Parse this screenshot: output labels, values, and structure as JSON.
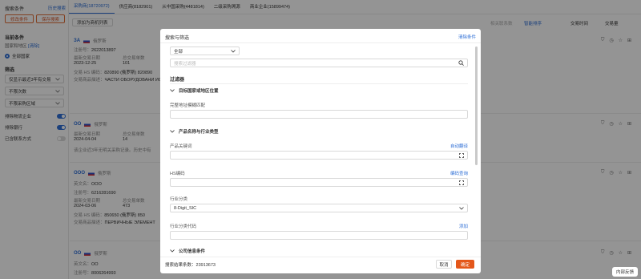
{
  "sidebar": {
    "title": "搜索条件",
    "history_link": "历史搜索",
    "modify_button": "修改条件",
    "save_button": "保存搜索",
    "current_conditions": "当前条件",
    "country_label": "国家和地区",
    "country_clear": "[清除]",
    "all_countries": "全部国家",
    "filter_heading": "筛选",
    "selects": [
      "仅显示最近3年有交易",
      "不限次数",
      "不限采购区域"
    ],
    "toggles": [
      {
        "label": "排除物流企业",
        "on": true
      },
      {
        "label": "排除银行",
        "on": true
      },
      {
        "label": "已含联系方式",
        "on": false
      }
    ]
  },
  "tabs": [
    {
      "label": "采购商(18720972)",
      "active": true
    },
    {
      "label": "供应商(8182901)",
      "active": false
    },
    {
      "label": "从中国采购(4481814)",
      "active": false
    },
    {
      "label": "二级采购溯源",
      "active": false
    },
    {
      "label": "商业企业(15899474)",
      "active": false
    }
  ],
  "toolbar": {
    "add_list": "添加为商机列表",
    "related_contacts": "相关联系数",
    "smart_sort": "智能排序",
    "trade_time": "交易时间",
    "trade_count": "交易量"
  },
  "rows": [
    {
      "name": "ЗА",
      "country": "俄罗斯",
      "reg_label": "注册号：",
      "reg": "2622013897",
      "last_label": "最新交易日期",
      "last_date": "2023-12-25",
      "total_label": "总交易单数",
      "total": "101",
      "hs_label": "交易 HS 编码：",
      "hs": "820890 (俄罗斯)  820890",
      "desc_label": "交易商品描述：",
      "desc": "ЧАСТИ ОБОРУДОВАНИ ИСКЛЮЧИТЕЛЬНО ДЛЯ"
    },
    {
      "name": "ОО",
      "country": "俄罗斯",
      "last_label": "最新交易日期",
      "last_date": "2024-04-04",
      "total_label": "总交易单数",
      "total": "14",
      "note": "该企业近3年无明关采购记录。历史中有"
    },
    {
      "name": "ООО",
      "country": "俄罗斯",
      "en_label": "英文名：",
      "en": "ООО",
      "reg_label": "注册号：",
      "reg": "6216281690",
      "last_label": "最新交易日期",
      "last_date": "2024-03-06",
      "total_label": "总交易单数",
      "total": "473",
      "hs_label": "交易 HS 编码：",
      "hs": "850650 (俄罗斯)  850",
      "desc_label": "交易商品描述：",
      "desc": "ПЕРВИЧНЫЕ ЭЛЕМЕНТ"
    },
    {
      "name": "ОО",
      "country": "俄罗斯",
      "en_label": "英文名：",
      "en": "ОО",
      "reg_label": "注册号：",
      "reg": "8006264993"
    }
  ],
  "modal": {
    "title": "搜索与筛选",
    "clear": "清除条件",
    "scope": "全部",
    "search_placeholder": "搜索过滤器",
    "filters_heading": "过滤器",
    "sec_region": "目标国家或地区位置",
    "address_label": "完整地址模糊匹配",
    "sec_product": "产品名称与行业类型",
    "keyword_label": "产品关键词",
    "auto_translate": "自动翻译",
    "hs_label": "HS编码",
    "hs_lookup": "编码查询",
    "industry_label": "行业分类",
    "industry_value": "8-Digit_SIC",
    "industry_code_label": "行业分类代码",
    "add": "添加",
    "sec_company": "公司信息条件",
    "result_label": "搜索结果条数：",
    "result_count": "23913673",
    "cancel": "取消",
    "ok": "确定"
  },
  "feedback": "内部反馈"
}
